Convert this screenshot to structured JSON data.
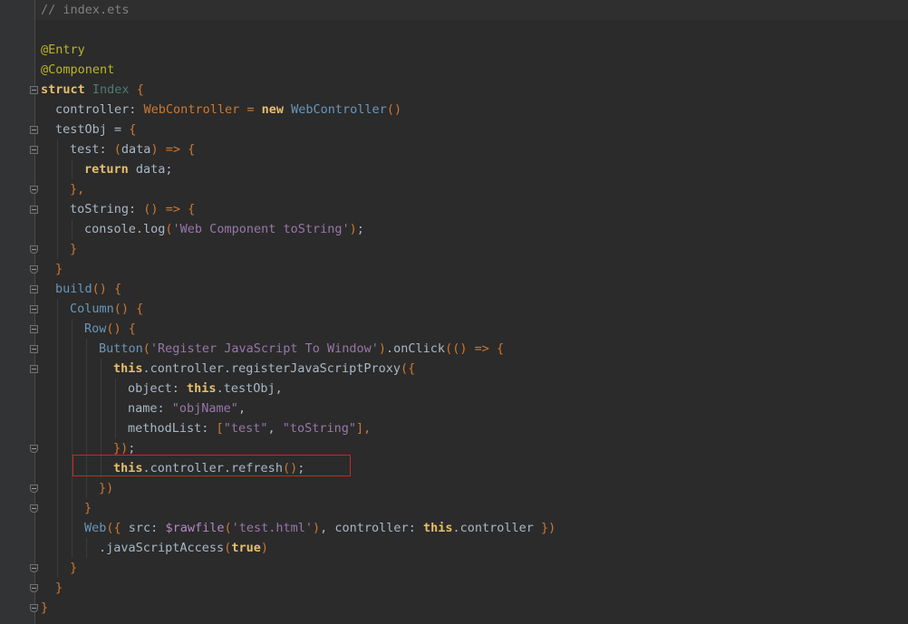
{
  "editor": {
    "lines": [
      {
        "indent": 0,
        "tokens": [
          {
            "t": "// index.ets",
            "c": "tok-comment"
          }
        ]
      },
      {
        "indent": 0,
        "tokens": []
      },
      {
        "indent": 0,
        "tokens": [
          {
            "t": "@Entry",
            "c": "tok-anno"
          }
        ]
      },
      {
        "indent": 0,
        "tokens": [
          {
            "t": "@Component",
            "c": "tok-anno"
          }
        ]
      },
      {
        "indent": 0,
        "tokens": [
          {
            "t": "struct",
            "c": "tok-kw2"
          },
          {
            "t": " ",
            "c": "tok-punc"
          },
          {
            "t": "Index",
            "c": "tok-type"
          },
          {
            "t": " {",
            "c": "tok-obj"
          }
        ]
      },
      {
        "indent": 1,
        "tokens": [
          {
            "t": "controller",
            "c": "tok-field"
          },
          {
            "t": ": ",
            "c": "tok-punc"
          },
          {
            "t": "WebController",
            "c": "tok-obj"
          },
          {
            "t": " = ",
            "c": "tok-obj"
          },
          {
            "t": "new",
            "c": "tok-kw2"
          },
          {
            "t": " ",
            "c": "tok-punc"
          },
          {
            "t": "WebController",
            "c": "tok-cls"
          },
          {
            "t": "()",
            "c": "tok-paren"
          }
        ]
      },
      {
        "indent": 1,
        "tokens": [
          {
            "t": "testObj",
            "c": "tok-field"
          },
          {
            "t": " = ",
            "c": "tok-punc"
          },
          {
            "t": "{",
            "c": "tok-obj"
          }
        ]
      },
      {
        "indent": 2,
        "tokens": [
          {
            "t": "test",
            "c": "tok-field"
          },
          {
            "t": ": ",
            "c": "tok-punc"
          },
          {
            "t": "(",
            "c": "tok-paren"
          },
          {
            "t": "data",
            "c": "tok-var"
          },
          {
            "t": ")",
            "c": "tok-paren"
          },
          {
            "t": " => ",
            "c": "tok-obj"
          },
          {
            "t": "{",
            "c": "tok-obj"
          }
        ]
      },
      {
        "indent": 3,
        "tokens": [
          {
            "t": "return",
            "c": "tok-kw2"
          },
          {
            "t": " data;",
            "c": "tok-punc"
          }
        ]
      },
      {
        "indent": 2,
        "tokens": [
          {
            "t": "},",
            "c": "tok-obj"
          }
        ]
      },
      {
        "indent": 2,
        "tokens": [
          {
            "t": "toString",
            "c": "tok-field"
          },
          {
            "t": ": ",
            "c": "tok-punc"
          },
          {
            "t": "()",
            "c": "tok-paren"
          },
          {
            "t": " => ",
            "c": "tok-obj"
          },
          {
            "t": "{",
            "c": "tok-obj"
          }
        ]
      },
      {
        "indent": 3,
        "tokens": [
          {
            "t": "console.log",
            "c": "tok-punc"
          },
          {
            "t": "(",
            "c": "tok-paren"
          },
          {
            "t": "'Web Component toString'",
            "c": "tok-str"
          },
          {
            "t": ")",
            "c": "tok-paren"
          },
          {
            "t": ";",
            "c": "tok-punc"
          }
        ]
      },
      {
        "indent": 2,
        "tokens": [
          {
            "t": "}",
            "c": "tok-obj"
          }
        ]
      },
      {
        "indent": 1,
        "tokens": [
          {
            "t": "}",
            "c": "tok-obj"
          }
        ]
      },
      {
        "indent": 1,
        "tokens": [
          {
            "t": "build",
            "c": "tok-cls"
          },
          {
            "t": "()",
            "c": "tok-paren"
          },
          {
            "t": " {",
            "c": "tok-obj"
          }
        ]
      },
      {
        "indent": 2,
        "tokens": [
          {
            "t": "Column",
            "c": "tok-cls"
          },
          {
            "t": "()",
            "c": "tok-paren"
          },
          {
            "t": " {",
            "c": "tok-obj"
          }
        ]
      },
      {
        "indent": 3,
        "tokens": [
          {
            "t": "Row",
            "c": "tok-cls"
          },
          {
            "t": "()",
            "c": "tok-paren"
          },
          {
            "t": " {",
            "c": "tok-obj"
          }
        ]
      },
      {
        "indent": 4,
        "tokens": [
          {
            "t": "Button",
            "c": "tok-cls"
          },
          {
            "t": "(",
            "c": "tok-paren"
          },
          {
            "t": "'Register JavaScript To Window'",
            "c": "tok-str"
          },
          {
            "t": ")",
            "c": "tok-paren"
          },
          {
            "t": ".onClick",
            "c": "tok-punc"
          },
          {
            "t": "(()",
            "c": "tok-paren"
          },
          {
            "t": " => ",
            "c": "tok-obj"
          },
          {
            "t": "{",
            "c": "tok-obj"
          }
        ]
      },
      {
        "indent": 5,
        "tokens": [
          {
            "t": "this",
            "c": "tok-kw2"
          },
          {
            "t": ".controller.registerJavaScriptProxy",
            "c": "tok-punc"
          },
          {
            "t": "({",
            "c": "tok-paren"
          }
        ]
      },
      {
        "indent": 6,
        "tokens": [
          {
            "t": "object",
            "c": "tok-field"
          },
          {
            "t": ": ",
            "c": "tok-punc"
          },
          {
            "t": "this",
            "c": "tok-kw2"
          },
          {
            "t": ".testObj,",
            "c": "tok-punc"
          }
        ]
      },
      {
        "indent": 6,
        "tokens": [
          {
            "t": "name",
            "c": "tok-field"
          },
          {
            "t": ": ",
            "c": "tok-punc"
          },
          {
            "t": "\"objName\"",
            "c": "tok-str"
          },
          {
            "t": ",",
            "c": "tok-punc"
          }
        ]
      },
      {
        "indent": 6,
        "tokens": [
          {
            "t": "methodList",
            "c": "tok-field"
          },
          {
            "t": ": ",
            "c": "tok-punc"
          },
          {
            "t": "[",
            "c": "tok-obj"
          },
          {
            "t": "\"test\"",
            "c": "tok-str"
          },
          {
            "t": ", ",
            "c": "tok-punc"
          },
          {
            "t": "\"toString\"",
            "c": "tok-str"
          },
          {
            "t": "],",
            "c": "tok-obj"
          }
        ]
      },
      {
        "indent": 5,
        "tokens": [
          {
            "t": "})",
            "c": "tok-paren"
          },
          {
            "t": ";",
            "c": "tok-punc"
          }
        ]
      },
      {
        "indent": 5,
        "tokens": [
          {
            "t": "this",
            "c": "tok-kw2"
          },
          {
            "t": ".controller.refresh",
            "c": "tok-punc"
          },
          {
            "t": "()",
            "c": "tok-paren"
          },
          {
            "t": ";",
            "c": "tok-punc"
          }
        ]
      },
      {
        "indent": 4,
        "tokens": [
          {
            "t": "})",
            "c": "tok-paren"
          }
        ]
      },
      {
        "indent": 3,
        "tokens": [
          {
            "t": "}",
            "c": "tok-obj"
          }
        ]
      },
      {
        "indent": 3,
        "tokens": [
          {
            "t": "Web",
            "c": "tok-cls"
          },
          {
            "t": "({",
            "c": "tok-paren"
          },
          {
            "t": " src: ",
            "c": "tok-punc"
          },
          {
            "t": "$rawfile",
            "c": "tok-special"
          },
          {
            "t": "(",
            "c": "tok-paren"
          },
          {
            "t": "'test.html'",
            "c": "tok-str"
          },
          {
            "t": ")",
            "c": "tok-paren"
          },
          {
            "t": ", controller: ",
            "c": "tok-punc"
          },
          {
            "t": "this",
            "c": "tok-kw2"
          },
          {
            "t": ".controller ",
            "c": "tok-punc"
          },
          {
            "t": "})",
            "c": "tok-paren"
          }
        ]
      },
      {
        "indent": 4,
        "tokens": [
          {
            "t": ".javaScriptAccess",
            "c": "tok-punc"
          },
          {
            "t": "(",
            "c": "tok-paren"
          },
          {
            "t": "true",
            "c": "tok-kw2"
          },
          {
            "t": ")",
            "c": "tok-paren"
          }
        ]
      },
      {
        "indent": 2,
        "tokens": [
          {
            "t": "}",
            "c": "tok-obj"
          }
        ]
      },
      {
        "indent": 1,
        "tokens": [
          {
            "t": "}",
            "c": "tok-obj"
          }
        ]
      },
      {
        "indent": 0,
        "tokens": [
          {
            "t": "}",
            "c": "tok-obj"
          }
        ]
      }
    ],
    "fold_markers": [
      {
        "line": 4,
        "kind": "open"
      },
      {
        "line": 6,
        "kind": "open"
      },
      {
        "line": 7,
        "kind": "open"
      },
      {
        "line": 9,
        "kind": "end"
      },
      {
        "line": 10,
        "kind": "open"
      },
      {
        "line": 12,
        "kind": "end"
      },
      {
        "line": 13,
        "kind": "end"
      },
      {
        "line": 14,
        "kind": "open"
      },
      {
        "line": 15,
        "kind": "open"
      },
      {
        "line": 16,
        "kind": "open"
      },
      {
        "line": 17,
        "kind": "open"
      },
      {
        "line": 18,
        "kind": "open"
      },
      {
        "line": 22,
        "kind": "end"
      },
      {
        "line": 24,
        "kind": "end"
      },
      {
        "line": 25,
        "kind": "end"
      },
      {
        "line": 28,
        "kind": "end"
      },
      {
        "line": 29,
        "kind": "end"
      },
      {
        "line": 30,
        "kind": "end"
      }
    ],
    "highlighted_line": 23,
    "colors": {
      "background": "#2b2b2b",
      "highlight_border": "#c62828"
    }
  }
}
